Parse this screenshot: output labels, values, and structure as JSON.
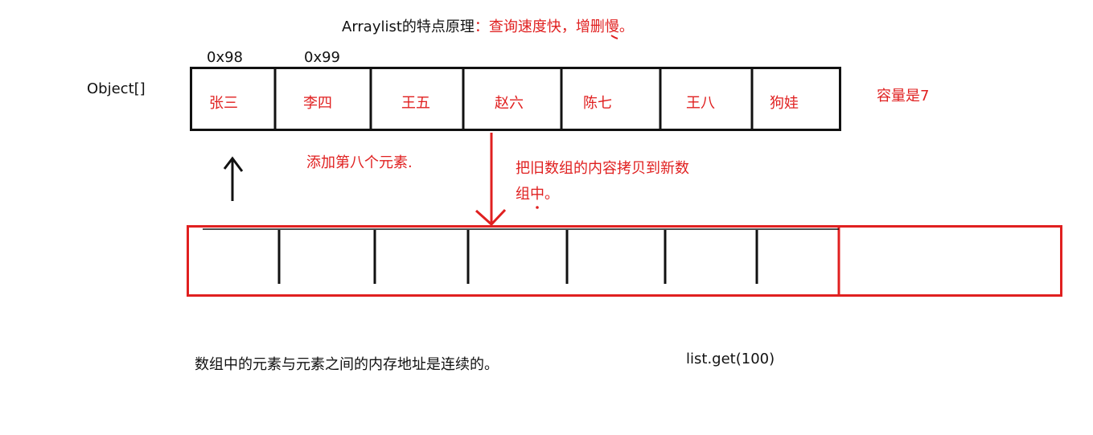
{
  "title": {
    "prefix": "Arraylist的特点原理",
    "highlight": "：查询速度快，增删慢。"
  },
  "addresses": [
    "0x98",
    "0x99"
  ],
  "array_type_label": "Object[]",
  "old_array": {
    "elements": [
      "张三",
      "李四",
      "王五",
      "赵六",
      "陈七",
      "王八",
      "狗娃"
    ]
  },
  "capacity_label": "容量是7",
  "add_label": "添加第八个元素.",
  "copy_label_line1": "把旧数组的内容拷贝到新数",
  "copy_label_line2": "组中。",
  "contiguous_label": "数组中的元素与元素之间的内存地址是连续的。",
  "get_call": "list.get(100)",
  "colors": {
    "accent": "#e02020",
    "ink": "#111111"
  }
}
